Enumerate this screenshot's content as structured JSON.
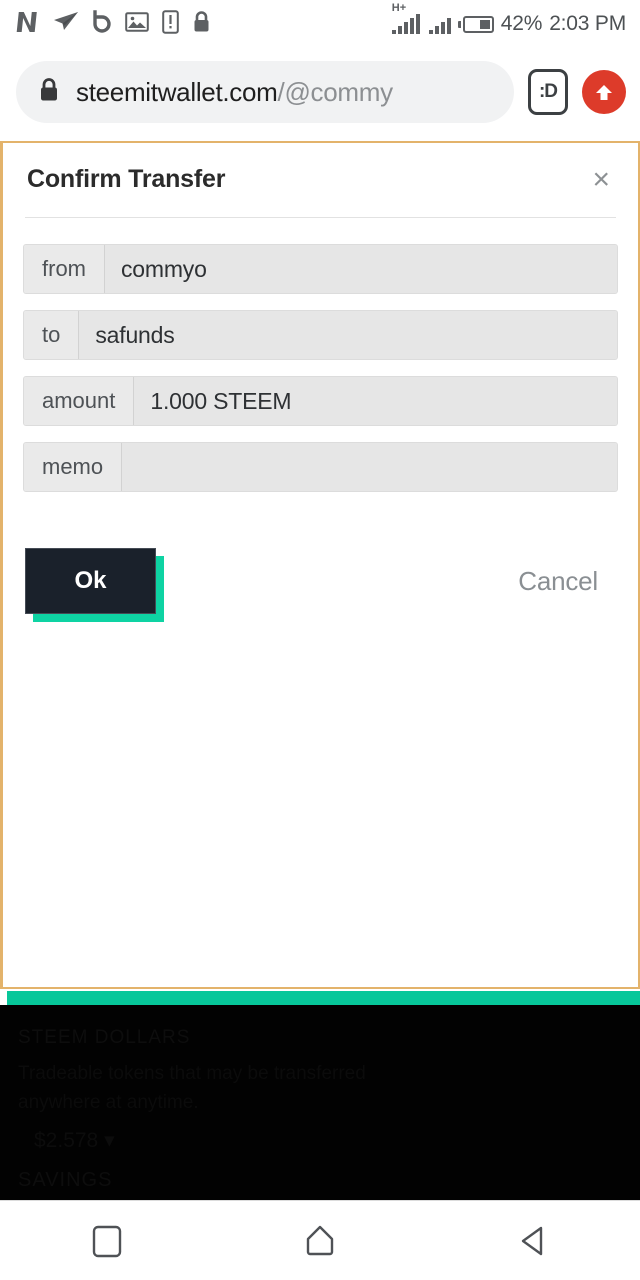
{
  "status_bar": {
    "notification_icons": [
      {
        "name": "netflix-icon",
        "label": "N"
      },
      {
        "name": "telegram-icon",
        "label": "paper-plane"
      },
      {
        "name": "brave-icon",
        "label": "b"
      },
      {
        "name": "image-icon",
        "label": "photo"
      },
      {
        "name": "phone-alert-icon",
        "label": "phone-exclamation"
      },
      {
        "name": "lock-icon",
        "label": "lock"
      }
    ],
    "network_type": "H+",
    "battery_percent": "42%",
    "clock": "2:03 PM"
  },
  "browser": {
    "url_domain": "steemitwallet.com",
    "url_path": "/@commy",
    "lock_icon": "lock-icon",
    "privacy_icon_label": ":D",
    "upload_icon": "arrow-up-icon"
  },
  "dialog": {
    "title": "Confirm Transfer",
    "close_label": "×",
    "fields": [
      {
        "label": "from",
        "value": "commyo"
      },
      {
        "label": "to",
        "value": "safunds"
      },
      {
        "label": "amount",
        "value": "1.000 STEEM"
      },
      {
        "label": "memo",
        "value": ""
      }
    ],
    "ok_label": "Ok",
    "cancel_label": "Cancel",
    "colors": {
      "border": "#e3b36b",
      "ok_bg": "#1a212b",
      "ok_shadow": "#0ed3a3",
      "cancel_text": "#8a8f93"
    }
  },
  "background_page": {
    "accent_bar_color": "#07c79a",
    "section_heading": "STEEM DOLLARS",
    "section_body": "Tradeable tokens that may be transferred anywhere at anytime.",
    "section_amount": "$2.578",
    "section_caret": "▾",
    "savings_heading": "SAVINGS"
  },
  "nav_bar": {
    "recents_label": "recents",
    "home_label": "home",
    "back_label": "back"
  }
}
